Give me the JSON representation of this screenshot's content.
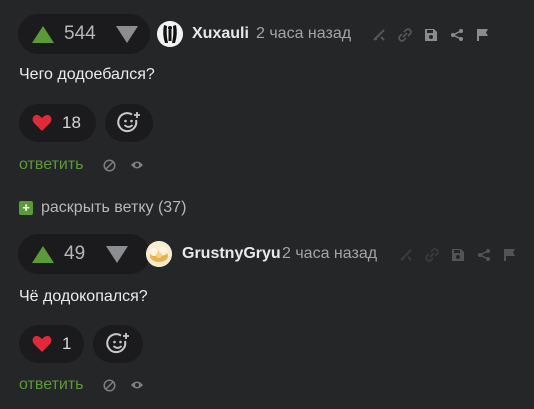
{
  "comments": [
    {
      "score": "544",
      "username": "Xuxauli",
      "time": "2 часа назад",
      "text": "Чего додоебался?",
      "likes": "18",
      "reply_label": "ответить"
    },
    {
      "score": "49",
      "username": "GrustnyGryu",
      "time": "2 часа назад",
      "text": "Чё додокопался?",
      "likes": "1",
      "reply_label": "ответить"
    }
  ],
  "expand_thread": {
    "icon": "+",
    "label": "раскрыть ветку (37)"
  },
  "icons": {
    "upvote": "upvote-arrow-icon",
    "downvote": "downvote-arrow-icon",
    "toolbar": [
      "branch-icon",
      "link-icon",
      "save-icon",
      "share-icon",
      "flag-icon"
    ],
    "like": "heart-icon",
    "emoji": "add-emoji-icon",
    "hide": "hide-icon",
    "view": "eye-icon"
  },
  "colors": {
    "background": "#252628",
    "pill": "#1b1b1d",
    "accent_green": "#5b9a39",
    "heart_red": "#e02a3a",
    "muted": "#a2a4a7"
  }
}
